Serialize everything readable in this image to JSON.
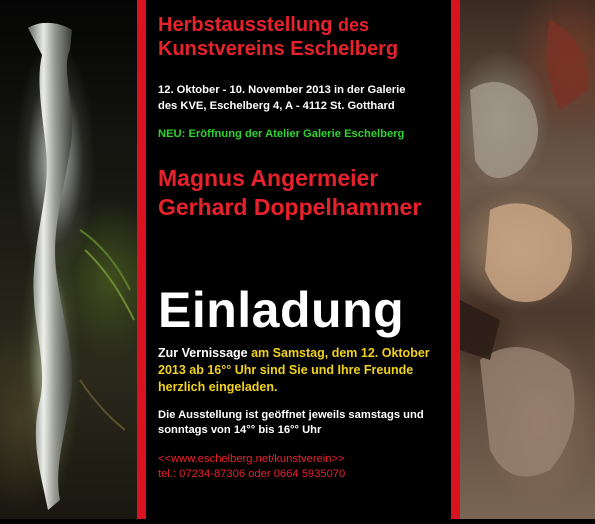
{
  "heading": {
    "line1_main": "Herbstausstellung",
    "line1_suffix": "des",
    "line2": "Kunstvereins Eschelberg"
  },
  "dates": {
    "line1": "12. Oktober - 10. November 2013 in der Galerie",
    "line2": "des KVE,  Eschelberg 4,  A - 4112 St. Gotthard"
  },
  "news": "NEU: Eröffnung der Atelier Galerie Eschelberg",
  "artists": [
    "Magnus Angermeier",
    "Gerhard Doppelhammer"
  ],
  "title": "Einladung",
  "invite": {
    "part1": "Zur Vernissage ",
    "part2": "am Samstag, dem 12. Oktober 2013 ab 16°° Uhr ",
    "part3": "sind Sie und Ihre Freunde herzlich eingeladen."
  },
  "hours": "Die Ausstellung ist geöffnet jeweils samstags und sonntags von 14°° bis 16°° Uhr",
  "contact": {
    "website": "<<www.eschelberg.net/kunstverein>>",
    "phone": "tel.: 07234-87306  oder  0664 5935070"
  },
  "colors": {
    "accent_red": "#d8121f",
    "text_red": "#e8212b",
    "highlight_yellow": "#f2d21a",
    "news_green": "#2fd32f"
  }
}
